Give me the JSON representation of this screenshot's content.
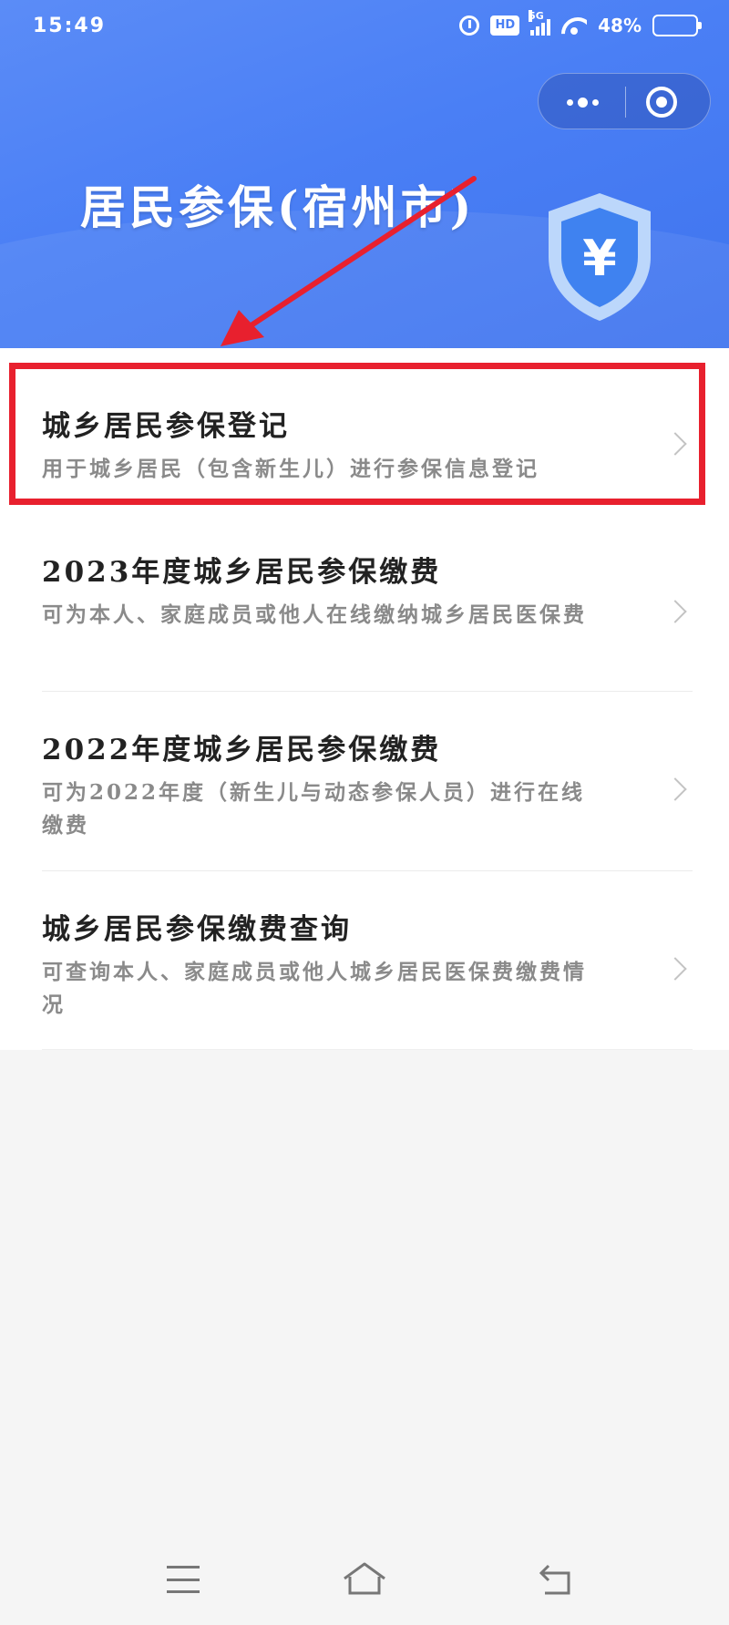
{
  "status_bar": {
    "time": "15:49",
    "network": "5G",
    "hd_label": "HD",
    "battery": "48%",
    "battery_level": 0.48
  },
  "header": {
    "title": "居民参保(宿州市)",
    "shield_symbol": "¥",
    "gradient_colors": [
      "#5b8cf7",
      "#3f74ee"
    ]
  },
  "capsule": {
    "more_icon": "more-dots-icon",
    "close_icon": "target-circle-icon"
  },
  "menu": {
    "items": [
      {
        "title": "城乡居民参保登记",
        "desc": "用于城乡居民（包含新生儿）进行参保信息登记"
      },
      {
        "title": "2023年度城乡居民参保缴费",
        "desc": "可为本人、家庭成员或他人在线缴纳城乡居民医保费"
      },
      {
        "title": "2022年度城乡居民参保缴费",
        "desc": "可为2022年度（新生儿与动态参保人员）进行在线缴费"
      },
      {
        "title": "城乡居民参保缴费查询",
        "desc": "可查询本人、家庭成员或他人城乡居民医保费缴费情况"
      }
    ]
  },
  "annotation": {
    "color": "#e8202e"
  },
  "nav_bar": {
    "icons": [
      "menu-icon",
      "home-icon",
      "back-icon"
    ]
  }
}
